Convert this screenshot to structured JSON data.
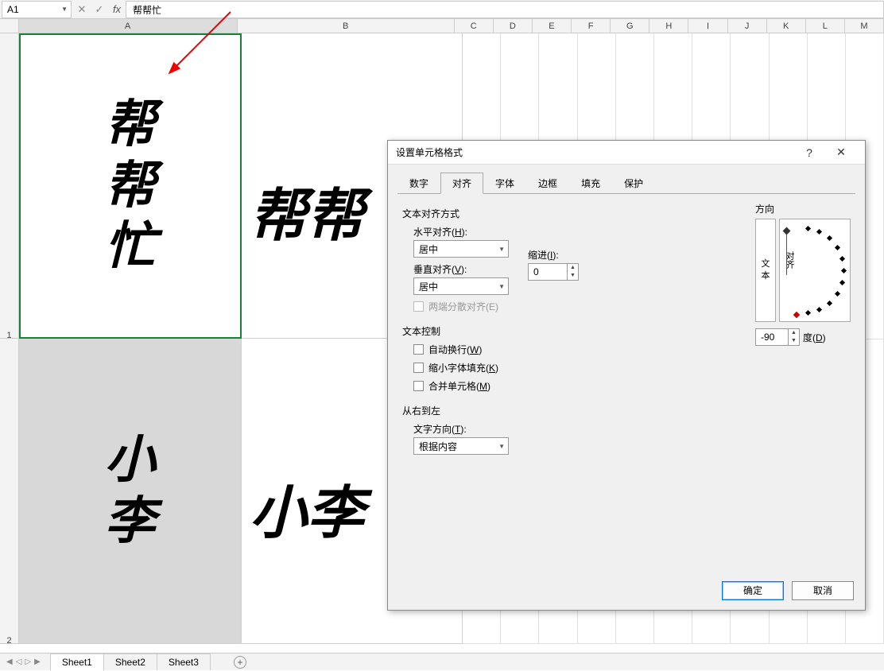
{
  "formula_bar": {
    "name_box": "A1",
    "cancel": "✕",
    "confirm": "✓",
    "fx": "fx",
    "content": "帮帮忙"
  },
  "columns": [
    "A",
    "B",
    "C",
    "D",
    "E",
    "F",
    "G",
    "H",
    "I",
    "J",
    "K",
    "L",
    "M"
  ],
  "rows": {
    "r1": "1",
    "r2": "2"
  },
  "cells": {
    "A1": {
      "c1": "帮",
      "c2": "帮",
      "c3": "忙"
    },
    "B1": "帮帮",
    "A2": {
      "c1": "小",
      "c2": "李"
    },
    "B2": "小李"
  },
  "dialog": {
    "title": "设置单元格格式",
    "help": "?",
    "close": "✕",
    "tabs": [
      "数字",
      "对齐",
      "字体",
      "边框",
      "填充",
      "保护"
    ],
    "active_tab_index": 1,
    "sections": {
      "text_align": "文本对齐方式",
      "h_align_label": "水平对齐(H):",
      "h_align_value": "居中",
      "indent_label": "缩进(I):",
      "indent_value": "0",
      "v_align_label": "垂直对齐(V):",
      "v_align_value": "居中",
      "justify_distributed": "两端分散对齐(E)",
      "text_control": "文本控制",
      "wrap_text": "自动换行(W)",
      "shrink_fit": "缩小字体填充(K)",
      "merge_cells": "合并单元格(M)",
      "rtl": "从右到左",
      "text_dir_label": "文字方向(T):",
      "text_dir_value": "根据内容",
      "orientation": "方向",
      "orient_vert": "文本",
      "orient_dial": "对齐",
      "degrees_value": "-90",
      "degrees_label": "度(D)"
    },
    "buttons": {
      "ok": "确定",
      "cancel": "取消"
    }
  },
  "sheets": {
    "nav": [
      "◀",
      "◁",
      "▷",
      "▶"
    ],
    "tabs": [
      "Sheet1",
      "Sheet2",
      "Sheet3"
    ],
    "active_index": 0,
    "add": "+"
  }
}
